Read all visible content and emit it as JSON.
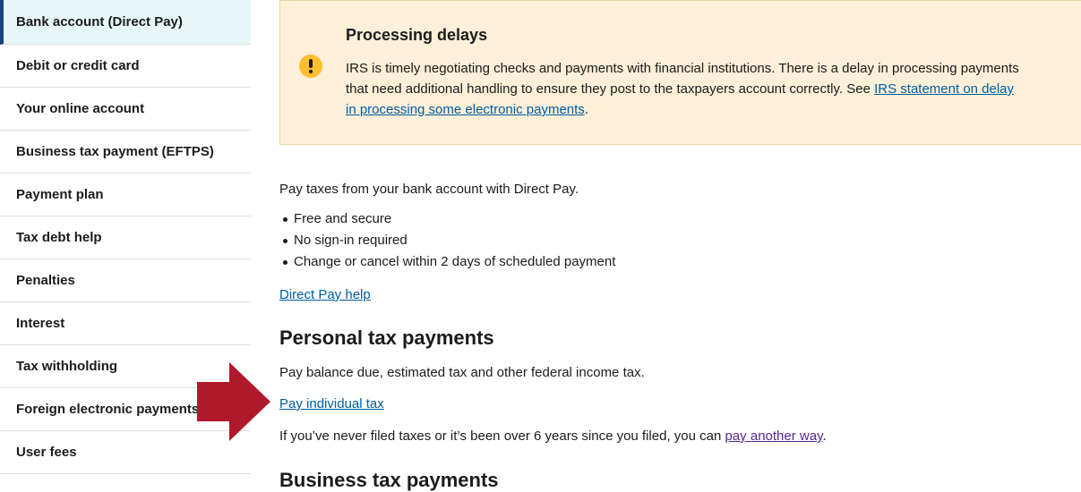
{
  "sidebar": {
    "items": [
      {
        "label": "Bank account (Direct Pay)",
        "active": true
      },
      {
        "label": "Debit or credit card"
      },
      {
        "label": "Your online account"
      },
      {
        "label": "Business tax payment (EFTPS)"
      },
      {
        "label": "Payment plan"
      },
      {
        "label": "Tax debt help"
      },
      {
        "label": "Penalties"
      },
      {
        "label": "Interest"
      },
      {
        "label": "Tax withholding"
      },
      {
        "label": "Foreign electronic payments"
      },
      {
        "label": "User fees"
      }
    ]
  },
  "alert": {
    "icon": "exclamation-icon",
    "title": "Processing delays",
    "body_pre": "IRS is timely negotiating checks and payments with financial institutions. There is a delay in processing payments that need additional handling to ensure they post to the taxpayers account correctly. See ",
    "link": "IRS statement on delay in processing some electronic payments",
    "body_post": "."
  },
  "main": {
    "intro": "Pay taxes from your bank account with Direct Pay.",
    "bullets": [
      "Free and secure",
      "No sign-in required",
      "Change or cancel within 2 days of scheduled payment"
    ],
    "direct_pay_help": "Direct Pay help",
    "personal_heading": "Personal tax payments",
    "personal_desc": "Pay balance due, estimated tax and other federal income tax.",
    "pay_individual": "Pay individual tax",
    "never_filed_pre": "If you’ve never filed taxes or it’s been over 6 years since you filed, you can ",
    "pay_another_way": "pay another way",
    "never_filed_post": ".",
    "business_heading": "Business tax payments"
  },
  "colors": {
    "link": "#005ea2",
    "visited": "#54278f",
    "alert_bg": "#fdefd8",
    "warning": "#ffbe2e",
    "arrow": "#b0192b",
    "active_nav_bg": "#e7f6f8"
  }
}
